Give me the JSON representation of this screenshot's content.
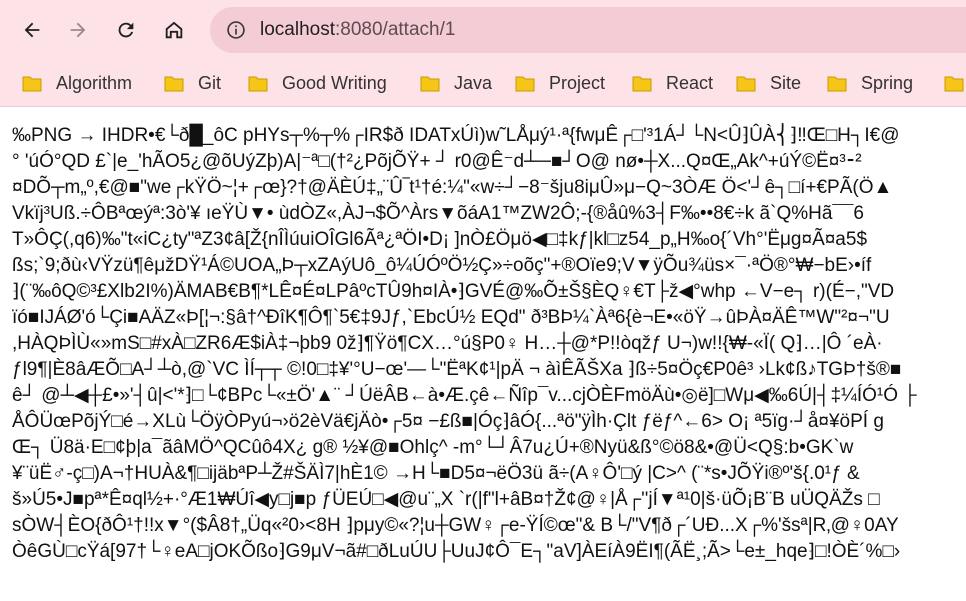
{
  "toolbar": {
    "url_host": "localhost",
    "url_path": ":8080/attach/1"
  },
  "bookmarks": [
    {
      "label": "Algorithm"
    },
    {
      "label": "Git"
    },
    {
      "label": "Good Writing"
    },
    {
      "label": "Java"
    },
    {
      "label": "Project"
    },
    {
      "label": "React"
    },
    {
      "label": "Site"
    },
    {
      "label": "Spring"
    }
  ],
  "colors": {
    "toolbar_bg": "#fde2e8",
    "omnibox_bg": "#f4ccd6",
    "folder": "#f5c518",
    "page_bg": "#ffffff"
  },
  "content": {
    "lines": [
      "‰PNG → IHDR•€└ð█_ôC pHYs┬%┬%┌IR$ð IDATxÚì)w˜LÅμý¹·ª{fwμÊ┌□'³1Á┘└N<Û⁆ÛÀ⎨⁆‼Œ□H┐I€@",
      "° 'úÓ°QD £`|e_'hÃO5¿@õUýZþ)A|⁻ª□(†²¿PõjÕŸ+ ┘ r0@Ê⁻d┴─■┘O@ nø•┼X...Q¤Œ„Ak^+úÝ©Ë¤³⁃²",
      "¤DÕ┬m„º,€@■\"we┌kŸÖ~¦+┌œ}?†@ÄÈÚ‡„¨Û‾t¹†é:¼\"«w÷┘−8⁻šju8iμÛ»μ−Q~3ÒÆ Ö<'┘ê┐□í+€PÃ(Ö▲",
      "Vkïj³Uß.÷ÔBªœýª:3ò'¥ ıeŸÙ▼• ùdÒZ«,ÀJ¬$Õ^Àrs▼õáA1™ZW2Ô;-{®åû%3┤F‰••8€÷k ã`Q%Hã¯¯6",
      "T»ÔÇ(,q6)‰\"t«iC¿ty\"ªZ3¢â[Ž{nÎÌúuiOÎGl6Ãª¿ªÖI•D¡ ]nÒ£Öμö◀□‡kƒ|kl□z54_p„H‰o{´Vh°'Ëμg¤Ã¤a5$",
      "ßs;`9;ðù‹VŸzü¶êμžDŸ¹Á©UOA„Þ┬xZAýUô_ô¼ÚÓºÖ½Ç»÷oõç\"+®Oïe9;V▼ÿÕu¾üs×¯·ªÖ®°₩−bE›•íf",
      "⁆(¨‰ôQ©³£Xlb2I%)ÄMAB€B¶*LÊ¤É¤LPâºcTÛ9h¤IÀ•⁆GVÉ@‰Õ±Š§ÈQ♀€T├ž◀°whp ←V−e┐ r)(É−,\"VD",
      "ïó■IJÁØ'ó└Çi■AÄZ«Þ[¦¬:§â†^ÐîK¶Ô¶`5€‡9Jƒ,`EbcÚ½ EQd\" ð³BÞ¼`Àª6{è¬E•«öŸ→ûÞÀ¤ÄÊ™W\"²¤¬\"U",
      ",HÀQÞÌÙ«»mS□#xÀ□ZR6Æ$iÀ‡¬þb9 0ž⁆¶Ÿö¶CX…°ú§P0♀ H…┼@*P!!òqžƒ U¬)w!!{₩-«Ï( Q⁆…|Ô ´eÀ·",
      "ƒl9¶|È8âÆÕ□A┘┴ò,@`VC ÌÍ┬┬ ©!0□‡¥'°U−œ'—└\"ËªK¢¹|pÄ ¬ àìÊÃŠXa ⁆ß÷5¤Öç€P0ê³ ›Lk¢ß♪TGÞ†š®■",
      "ê┘ @┴◀┼£•»'┤û|<'*⁆□└¢BPc└«±Ö'▲¨ ┘ÚëÂB←à•Æ.çê←Ñîp¯v...cjÒÈFmöÄù•◎ë]□Wμ◀‰6Ú|┤‡¼ÍÓ¹Ó ├",
      "ÅÔÜœPõjÝ□é→XLù└ÖÿÒPyú¬›ö2èVä€jÄò•┌5¤ −£ß■|Óç⁆âÓ{...ªö\"ÿÌh·Çlt ƒëƒ^←6> O¡ ª5ïg·┘å¤¥öPÍ g",
      "Œ┐ Ü8ä·E□¢þ|a¯ãâMÖ^QCûô4X¿ g® ½¥@■Ohlç^ -m°└┘Â7u¿Ú+®Nyü&ß°©ö8&•@Ü<Q§:b•GK`w",
      "¥¨üË♂-ç□)A¬†HUÀ&¶□ijäbªP┴Ž#ŠÄÌ7|hÈ1© →H└■D5¤¬ëÖ3ü ã÷(A♀Ô'□ý |C>^ (¨*s•JÕŸi®º'š{.0¹ƒ &",
      "š»Ú5•J■pª*Ê¤ql½+·°Æ1₩Úî◀y□j■p ƒÜEÚ□◀@u¨„X `r(|f\"l+âB¤†Ž¢@♀|Å┌''jÍ▼ª¹0|š·üÕ¡B¨B uÜQÄŽs □",
      "sÒW┤ÈO{ðÔ¹†!!x▼°($Â8†„Üq«²0›<8H ⁆pμy©«?¦u┼GW♀┌e-ŸÍ©œ\"& B└/\"V¶ð┌´UÐ...X┌%'šsª|R‚@♀0AY",
      "ÒêGÙ□cŸá[97†└♀eA□jOKÕßo⁆G9μV¬ã#□ðLuÚU├UuJ¢Ô¯E┐\"aV]ÀEíÀ9ËI¶(ÃË¸;Ã>└e±_hqe⁆□!ÒÈ´%□›"
    ]
  }
}
